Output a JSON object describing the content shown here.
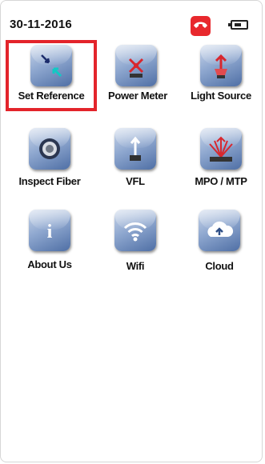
{
  "status_bar": {
    "date": "30-11-2016",
    "icons": [
      "phone-icon",
      "battery-icon"
    ],
    "phone_color": "#e8282d"
  },
  "menu": {
    "items": [
      {
        "label": "Set Reference",
        "icon": "set-reference-icon",
        "selected": true
      },
      {
        "label": "Power Meter",
        "icon": "power-meter-icon"
      },
      {
        "label": "Light Source",
        "icon": "light-source-icon"
      },
      {
        "label": "Inspect Fiber",
        "icon": "inspect-fiber-icon"
      },
      {
        "label": "VFL",
        "icon": "vfl-icon"
      },
      {
        "label": "MPO / MTP",
        "icon": "mpo-mtp-icon"
      },
      {
        "label": "About Us",
        "icon": "info-icon"
      },
      {
        "label": "Wifi",
        "icon": "wifi-icon"
      },
      {
        "label": "Cloud",
        "icon": "cloud-icon"
      }
    ]
  },
  "colors": {
    "highlight": "#e3242b",
    "tile": "#6f8cbd"
  }
}
